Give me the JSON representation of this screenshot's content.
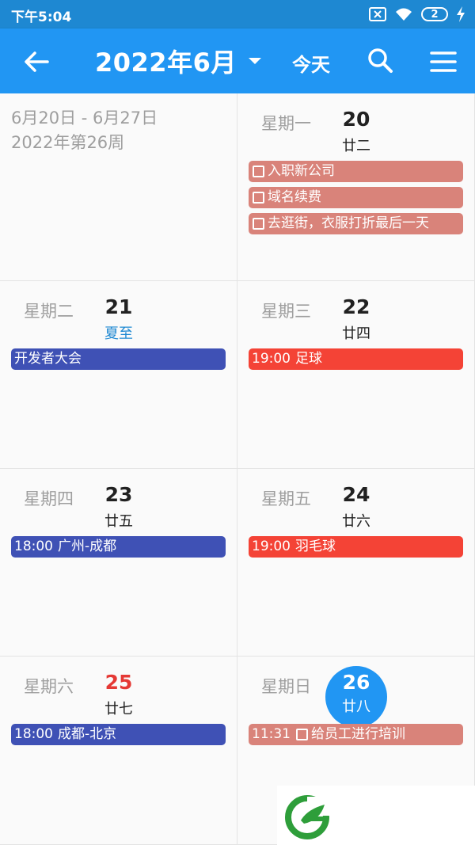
{
  "status": {
    "time": "下午5:04",
    "sim_badge": "2"
  },
  "appbar": {
    "title": "2022年6月",
    "today_label": "今天"
  },
  "week": {
    "range": "6月20日 - 6月27日",
    "week_label": "2022年第26周"
  },
  "days": [
    {
      "dow": "星期一",
      "num": "20",
      "lunar": "廿二",
      "events": [
        {
          "text": "入职新公司",
          "checkbox": true,
          "color": "pink"
        },
        {
          "text": "域名续费",
          "checkbox": true,
          "color": "pink"
        },
        {
          "text": "去逛街，衣服打折最后一天",
          "checkbox": true,
          "color": "pink"
        }
      ]
    },
    {
      "dow": "星期二",
      "num": "21",
      "lunar": "夏至",
      "events": [
        {
          "text": "开发者大会",
          "color": "blue"
        }
      ]
    },
    {
      "dow": "星期三",
      "num": "22",
      "lunar": "廿四",
      "events": [
        {
          "time": "19:00",
          "text": "足球",
          "color": "red"
        }
      ]
    },
    {
      "dow": "星期四",
      "num": "23",
      "lunar": "廿五",
      "events": [
        {
          "time": "18:00",
          "text": "广州-成都",
          "color": "blue"
        }
      ]
    },
    {
      "dow": "星期五",
      "num": "24",
      "lunar": "廿六",
      "events": [
        {
          "time": "19:00",
          "text": "羽毛球",
          "color": "red"
        }
      ]
    },
    {
      "dow": "星期六",
      "num": "25",
      "lunar": "廿七",
      "events": [
        {
          "time": "18:00",
          "text": "成都-北京",
          "color": "blue"
        }
      ]
    },
    {
      "dow": "星期日",
      "num": "26",
      "lunar": "廿八",
      "today": true,
      "events": [
        {
          "time": "11:31",
          "text": "给员工进行培训",
          "checkbox": true,
          "color": "pink"
        }
      ]
    }
  ],
  "colors": {
    "appbar": "#2196F3",
    "statusbar": "#1E88D2",
    "event_red": "#F44336",
    "event_blue": "#3F51B5",
    "event_pink": "#D9837A",
    "weekend_red": "#E53935"
  }
}
